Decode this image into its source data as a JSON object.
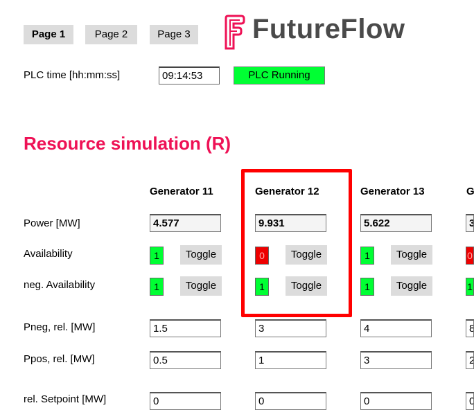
{
  "tabs": [
    {
      "label": "Page 1",
      "active": true
    },
    {
      "label": "Page 2",
      "active": false
    },
    {
      "label": "Page 3",
      "active": false
    }
  ],
  "logo": {
    "text": "FutureFlow",
    "icon": "futureflow-logo-icon",
    "accent": "#ee1155"
  },
  "plc": {
    "time_label": "PLC time [hh:mm:ss]",
    "time_value": "09:14:53",
    "status": "PLC Running",
    "status_color": "#00ff33"
  },
  "section_title": "Resource simulation (R)",
  "row_labels": {
    "power": "Power [MW]",
    "availability": "Availability",
    "neg_availability": "neg. Availability",
    "pneg": "Pneg, rel. [MW]",
    "ppos": "Ppos, rel. [MW]",
    "setpoint": "rel. Setpoint [MW]"
  },
  "toggle_label": "Toggle",
  "generators": [
    {
      "name": "Generator 11",
      "power": "4.577",
      "availability": "1",
      "neg_availability": "1",
      "pneg": "1.5",
      "ppos": "0.5",
      "setpoint": "0"
    },
    {
      "name": "Generator 12",
      "power": "9.931",
      "availability": "0",
      "neg_availability": "1",
      "pneg": "3",
      "ppos": "1",
      "setpoint": "0"
    },
    {
      "name": "Generator 13",
      "power": "5.622",
      "availability": "1",
      "neg_availability": "1",
      "pneg": "4",
      "ppos": "3",
      "setpoint": "0"
    },
    {
      "name": "G",
      "power": "3",
      "availability": "0",
      "neg_availability": "1",
      "pneg": "8",
      "ppos": "2",
      "setpoint": "0"
    }
  ],
  "colors": {
    "on": "#00ff33",
    "off": "#ee0000",
    "highlight": "#ff0000"
  }
}
